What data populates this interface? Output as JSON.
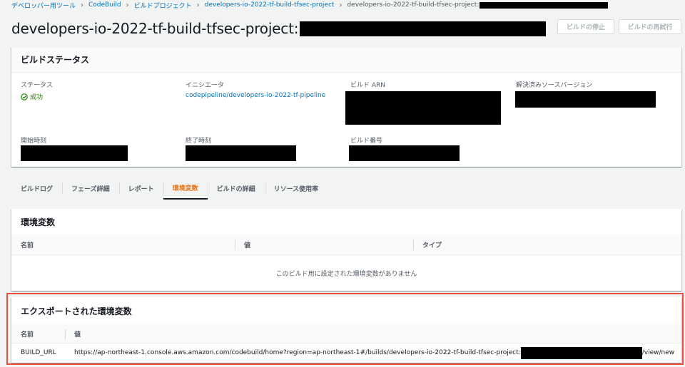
{
  "breadcrumb": {
    "items": [
      "デベロッパー用ツール",
      "CodeBuild",
      "ビルドプロジェクト",
      "developers-io-2022-tf-build-tfsec-project"
    ],
    "current": "developers-io-2022-tf-build-tfsec-project:"
  },
  "header": {
    "title": "developers-io-2022-tf-build-tfsec-project:",
    "stop_button": "ビルドの停止",
    "retry_button": "ビルドの再試行"
  },
  "build_status": {
    "heading": "ビルドステータス",
    "status_label": "ステータス",
    "status_value": "成功",
    "initiator_label": "イニシエータ",
    "initiator_value": "codepipeline/developers-io-2022-tf-pipeline",
    "arn_label": "ビルド ARN",
    "source_version_label": "解決済みソースバージョン",
    "start_label": "開始時刻",
    "end_label": "終了時刻",
    "build_number_label": "ビルド番号"
  },
  "tabs": [
    "ビルドログ",
    "フェーズ詳細",
    "レポート",
    "環境変数",
    "ビルドの詳細",
    "リソース使用率"
  ],
  "active_tab": "環境変数",
  "env_vars": {
    "heading": "環境変数",
    "columns": [
      "名前",
      "値",
      "タイプ"
    ],
    "empty_message": "このビルド用に設定された環境変数がありません"
  },
  "exported_vars": {
    "heading": "エクスポートされた環境変数",
    "columns": [
      "名前",
      "値"
    ],
    "rows": [
      {
        "name": "BUILD_URL",
        "value_prefix": "https://ap-northeast-1.console.aws.amazon.com/codebuild/home?region=ap-northeast-1#/builds/developers-io-2022-tf-build-tfsec-project:",
        "value_suffix": "/view/new"
      }
    ]
  },
  "colors": {
    "accent": "#ec7211",
    "link": "#0073bb",
    "success": "#1d8102",
    "highlight_border": "#e8503a"
  }
}
